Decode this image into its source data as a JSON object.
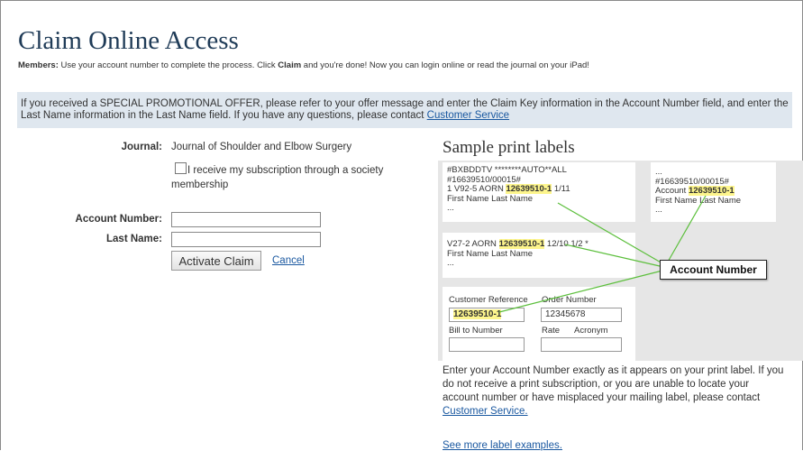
{
  "header": {
    "title": "Claim Online Access",
    "members_label": "Members:",
    "members_pre": " Use your account number to complete the process. Click ",
    "members_claim": "Claim",
    "members_post": " and you're done! Now you can login online or read the journal on your iPad!"
  },
  "notice": {
    "text": "If you received a SPECIAL PROMOTIONAL OFFER, please refer to your offer message and enter the Claim Key information in the Account Number field, and enter the Last Name information in the Last Name field. If you have any questions, please contact ",
    "link": "Customer Service"
  },
  "form": {
    "journal_label": "Journal:",
    "journal_value": "Journal of Shoulder and Elbow Surgery",
    "society_checkbox_label": "I receive my subscription through a society membership",
    "account_number_label": "Account Number:",
    "last_name_label": "Last Name:",
    "account_number_value": "",
    "last_name_value": "",
    "activate_button": "Activate Claim",
    "cancel_link": "Cancel"
  },
  "samples": {
    "title": "Sample print labels",
    "label1": {
      "line1": "#BXBDDTV  ********AUTO**ALL",
      "line2": "#16639510/00015#",
      "line3_pre": "1 V92-5 AORN ",
      "line3_hl": "12639510-1",
      "line3_post": " 1/11",
      "line4": "First Name Last Name",
      "line5": "..."
    },
    "label2": {
      "line1": "...",
      "line2": "#16639510/00015#",
      "line3_pre": "Account ",
      "line3_hl": "12639510-1",
      "line4": "First Name Last Name",
      "line5": "..."
    },
    "label3": {
      "line1_pre": "V27-2 AORN ",
      "line1_hl": "12639510-1",
      "line1_post": " 12/10 1/2 *",
      "line2": "First Name Last Name",
      "line3": "..."
    },
    "label4": {
      "customer_reference_label": "Customer Reference",
      "customer_reference_value": "12639510-1",
      "order_number_label": "Order Number",
      "order_number_value": "12345678",
      "bill_to_label": "Bill to Number",
      "rate_label": "Rate",
      "acronym_label": "Acronym"
    },
    "callout": "Account Number",
    "highlight_color": "#fdf58c",
    "line_color": "#5cbf3c"
  },
  "instructions": {
    "text": "Enter your Account Number exactly as it appears on your print label. If you do not receive a print subscription, or you are unable to locate your account number or have misplaced your mailing label, please contact ",
    "link": "Customer Service."
  },
  "see_more": "See more label examples."
}
